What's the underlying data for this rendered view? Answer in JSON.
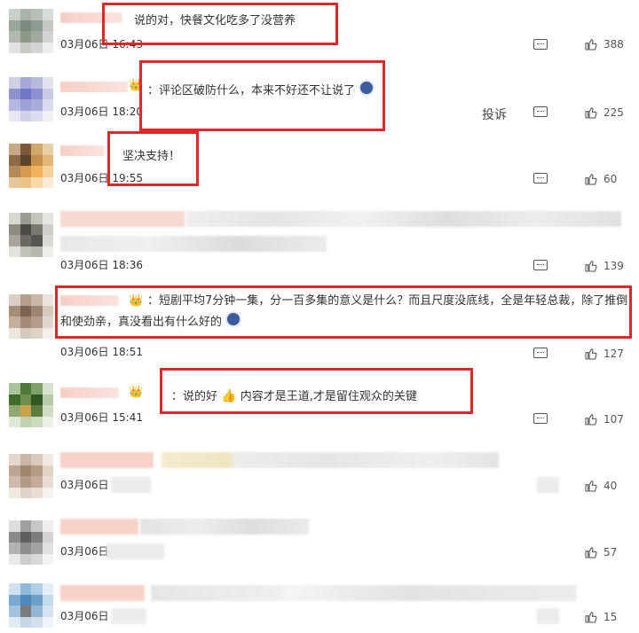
{
  "comments": [
    {
      "text": "说的对，快餐文化吃多了没营养",
      "date": "03月06日",
      "time": "16:43",
      "likes": "388"
    },
    {
      "text": "：评论区破防什么，本来不好还不让说了",
      "date": "03月06日",
      "time": "18:20",
      "likes": "225",
      "report": "投诉"
    },
    {
      "text": "坚决支持！",
      "date": "03月06日",
      "time": "19:55",
      "likes": "60"
    },
    {
      "text": "",
      "date": "03月06日",
      "time": "18:36",
      "likes": "139"
    },
    {
      "text": "：短剧平均7分钟一集，分一百多集的意义是什么？而且尺度没底线，全是年轻总裁，除了推倒和使劲亲，真没看出有什么好的",
      "date": "03月06日",
      "time": "18:51",
      "likes": "127"
    },
    {
      "text_a": "：说的好",
      "text_b": "内容才是王道,才是留住观众的关键",
      "date": "03月06日",
      "time": "15:41",
      "likes": "107"
    },
    {
      "text": "",
      "date": "03月06日",
      "time": "",
      "likes": "40"
    },
    {
      "text": "",
      "date": "03月06日",
      "time": "",
      "likes": "57"
    },
    {
      "text": "",
      "date": "03月06日",
      "time": "",
      "likes": "15"
    }
  ],
  "icons": {
    "reply": "comment-icon",
    "like": "thumbs-up-icon"
  },
  "colors": {
    "highlight": "#e02727"
  }
}
